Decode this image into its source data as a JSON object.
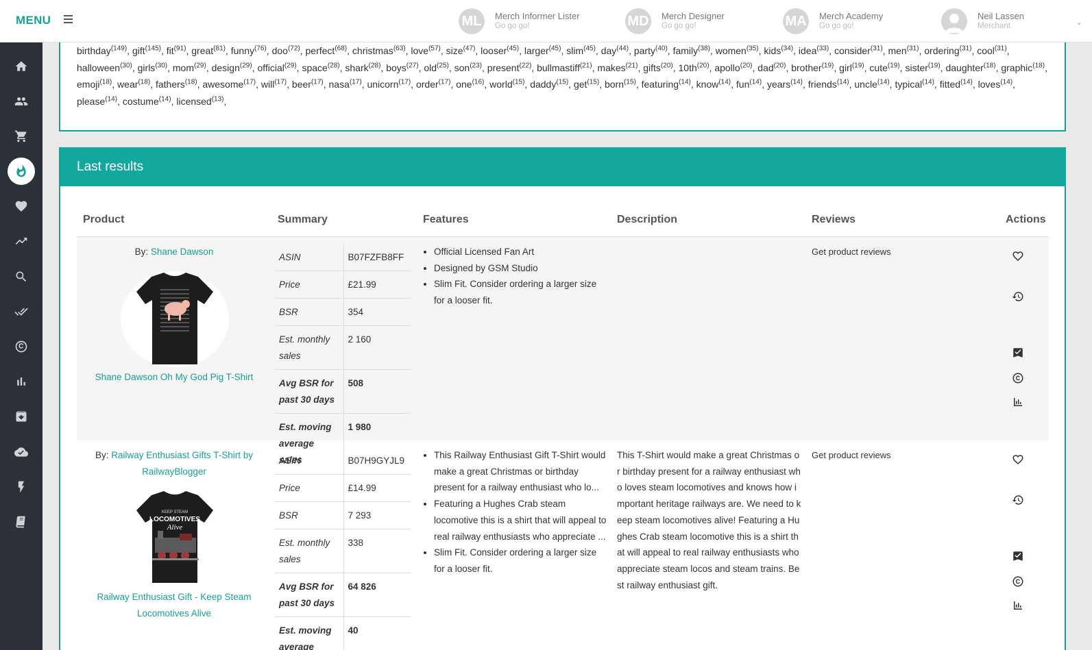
{
  "topbar": {
    "brand": "MENU",
    "apps": [
      {
        "initials": "ML",
        "title": "Merch Informer Lister",
        "subtitle": "Go go go!"
      },
      {
        "initials": "MD",
        "title": "Merch Designer",
        "subtitle": "Go go go!"
      },
      {
        "initials": "MA",
        "title": "Merch Academy",
        "subtitle": "Go go go!"
      }
    ],
    "user": {
      "name": "Neil Lassen",
      "role": "Merchant"
    }
  },
  "sidebar": {
    "items": [
      "home-icon",
      "users-icon",
      "cart-icon",
      "fire-icon",
      "heart-icon",
      "trending-icon",
      "search-icon",
      "double-check-icon",
      "copyright-icon",
      "bar-chart-icon",
      "archive-icon",
      "cloud-check-icon",
      "bolt-icon",
      "book-icon"
    ],
    "active": "fire-icon"
  },
  "keywords": [
    {
      "w": "birthday",
      "n": "149"
    },
    {
      "w": "gift",
      "n": "145"
    },
    {
      "w": "fit",
      "n": "91"
    },
    {
      "w": "great",
      "n": "81"
    },
    {
      "w": "funny",
      "n": "76"
    },
    {
      "w": "doo",
      "n": "72"
    },
    {
      "w": "perfect",
      "n": "68"
    },
    {
      "w": "christmas",
      "n": "63"
    },
    {
      "w": "love",
      "n": "57"
    },
    {
      "w": "size",
      "n": "47"
    },
    {
      "w": "looser",
      "n": "45"
    },
    {
      "w": "larger",
      "n": "45"
    },
    {
      "w": "slim",
      "n": "45"
    },
    {
      "w": "day",
      "n": "44"
    },
    {
      "w": "party",
      "n": "40"
    },
    {
      "w": "family",
      "n": "38"
    },
    {
      "w": "women",
      "n": "35"
    },
    {
      "w": "kids",
      "n": "34"
    },
    {
      "w": "idea",
      "n": "33"
    },
    {
      "w": "consider",
      "n": "31"
    },
    {
      "w": "men",
      "n": "31"
    },
    {
      "w": "ordering",
      "n": "31"
    },
    {
      "w": "cool",
      "n": "31"
    },
    {
      "w": "halloween",
      "n": "30"
    },
    {
      "w": "girls",
      "n": "30"
    },
    {
      "w": "mom",
      "n": "29"
    },
    {
      "w": "design",
      "n": "29"
    },
    {
      "w": "official",
      "n": "29"
    },
    {
      "w": "space",
      "n": "28"
    },
    {
      "w": "shark",
      "n": "28"
    },
    {
      "w": "boys",
      "n": "27"
    },
    {
      "w": "old",
      "n": "25"
    },
    {
      "w": "son",
      "n": "23"
    },
    {
      "w": "present",
      "n": "22"
    },
    {
      "w": "bullmastiff",
      "n": "21"
    },
    {
      "w": "makes",
      "n": "21"
    },
    {
      "w": "gifts",
      "n": "20"
    },
    {
      "w": "10th",
      "n": "20"
    },
    {
      "w": "apollo",
      "n": "20"
    },
    {
      "w": "dad",
      "n": "20"
    },
    {
      "w": "brother",
      "n": "19"
    },
    {
      "w": "girl",
      "n": "19"
    },
    {
      "w": "cute",
      "n": "19"
    },
    {
      "w": "sister",
      "n": "19"
    },
    {
      "w": "daughter",
      "n": "18"
    },
    {
      "w": "graphic",
      "n": "18"
    },
    {
      "w": "emoji",
      "n": "18"
    },
    {
      "w": "wear",
      "n": "18"
    },
    {
      "w": "fathers",
      "n": "18"
    },
    {
      "w": "awesome",
      "n": "17"
    },
    {
      "w": "will",
      "n": "17"
    },
    {
      "w": "beer",
      "n": "17"
    },
    {
      "w": "nasa",
      "n": "17"
    },
    {
      "w": "unicorn",
      "n": "17"
    },
    {
      "w": "order",
      "n": "17"
    },
    {
      "w": "one",
      "n": "16"
    },
    {
      "w": "world",
      "n": "15"
    },
    {
      "w": "daddy",
      "n": "15"
    },
    {
      "w": "get",
      "n": "15"
    },
    {
      "w": "born",
      "n": "15"
    },
    {
      "w": "featuring",
      "n": "14"
    },
    {
      "w": "know",
      "n": "14"
    },
    {
      "w": "fun",
      "n": "14"
    },
    {
      "w": "years",
      "n": "14"
    },
    {
      "w": "friends",
      "n": "14"
    },
    {
      "w": "uncle",
      "n": "14"
    },
    {
      "w": "typical",
      "n": "14"
    },
    {
      "w": "fitted",
      "n": "14"
    },
    {
      "w": "loves",
      "n": "14"
    },
    {
      "w": "please",
      "n": "14"
    },
    {
      "w": "costume",
      "n": "14"
    },
    {
      "w": "licensed",
      "n": "13"
    }
  ],
  "results": {
    "title": "Last results",
    "columns": [
      "Product",
      "Summary",
      "Features",
      "Description",
      "Reviews",
      "Actions"
    ],
    "rows": [
      {
        "by_label": "By:",
        "by": "Shane Dawson",
        "product_name": "Shane Dawson Oh My God Pig T-Shirt",
        "summary": [
          {
            "k": "ASIN",
            "v": "B07FZFB8FF"
          },
          {
            "k": "Price",
            "v": "£21.99"
          },
          {
            "k": "BSR",
            "v": "354"
          },
          {
            "k": "Est. monthly sales",
            "v": "2 160"
          },
          {
            "k": "Avg BSR for past 30 days",
            "v": "508"
          },
          {
            "k": "Est. moving average sales",
            "v": "1 980"
          }
        ],
        "features": [
          "Official Licensed Fan Art",
          "Designed by GSM Studio",
          "Slim Fit. Consider ordering a larger size for a looser fit."
        ],
        "description": "",
        "reviews": "Get product reviews"
      },
      {
        "by_label": "By:",
        "by": "Railway Enthusiast Gifts T-Shirt by RailwayBlogger",
        "product_name": "Railway Enthusiast Gift - Keep Steam Locomotives Alive",
        "summary": [
          {
            "k": "ASIN",
            "v": "B07H9GYJL9"
          },
          {
            "k": "Price",
            "v": "£14.99"
          },
          {
            "k": "BSR",
            "v": "7 293"
          },
          {
            "k": "Est. monthly sales",
            "v": "338"
          },
          {
            "k": "Avg BSR for past 30 days",
            "v": "64 826"
          },
          {
            "k": "Est. moving average sales",
            "v": "40"
          }
        ],
        "features": [
          "This Railway Enthusiast Gift T-Shirt would make a great Christmas or birthday present for a railway enthusiast who lo...",
          "Featuring a Hughes Crab steam locomotive this is a shirt that will appeal to real railway enthusiasts who appreciate ...",
          "Slim Fit. Consider ordering a larger size for a looser fit."
        ],
        "description": "This T-Shirt would make a great Christmas or birthday present for a railway enthusiast who loves steam locomotives and knows how important heritage railways are. We need to keep steam locomotives alive! Featuring a Hughes Crab steam locomotive this is a shirt that will appeal to real railway enthusiasts who appreciate steam locos and steam trains. Best railway enthusiast gift.",
        "reviews": "Get product reviews"
      }
    ],
    "shirt2_text": {
      "top": "KEEP STEAM",
      "mid": "LOCOMOTIVES",
      "bottom": "Alive"
    }
  },
  "colors": {
    "accent": "#12a89e",
    "link": "#16a096",
    "sidebar": "#2b3138"
  }
}
